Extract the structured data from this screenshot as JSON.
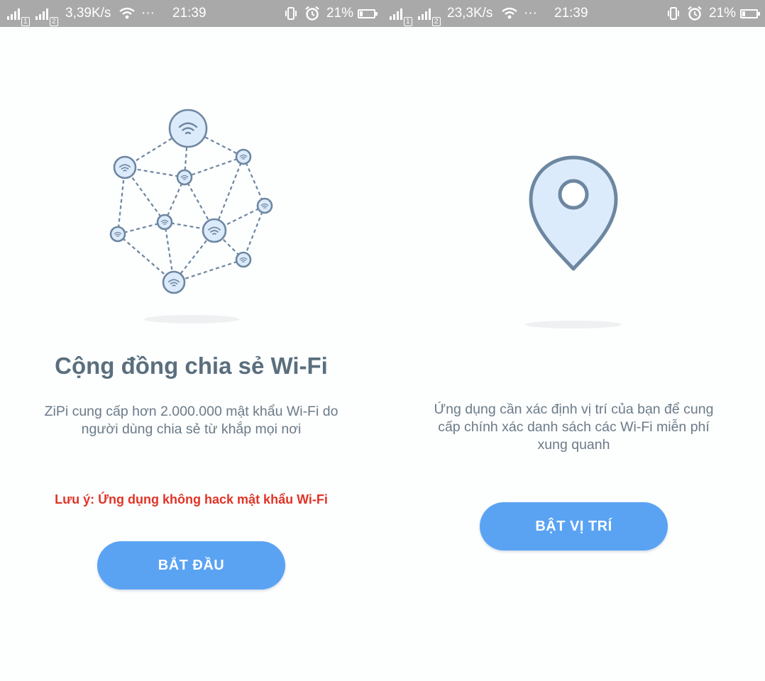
{
  "colors": {
    "status_bar_bg": "#a9a9a9",
    "button_bg": "#5aa3f3",
    "title_text": "#5a6f7e",
    "body_text": "#6b7b88",
    "warning_text": "#e03427",
    "icon_stroke": "#6d87a1",
    "icon_fill": "#dcebfb"
  },
  "left": {
    "status_bar": {
      "network_speed": "3,39K/s",
      "more": "···",
      "time": "21:39",
      "battery": "21%"
    },
    "illustration": "wifi-network-icon",
    "title": "Cộng đồng chia sẻ Wi-Fi",
    "description_line1": "ZiPi cung cấp hơn 2.000.000 mật khẩu Wi-Fi do",
    "description_line2": "người dùng chia sẻ từ khắp mọi nơi",
    "note": "Lưu ý: Ứng dụng không hack mật khẩu Wi-Fi",
    "button_label": "BẮT ĐẦU"
  },
  "right": {
    "status_bar": {
      "network_speed": "23,3K/s",
      "more": "···",
      "time": "21:39",
      "battery": "21%"
    },
    "illustration": "location-pin-icon",
    "description_line1": "Ứng dụng cần xác định vị trí của bạn để cung",
    "description_line2": "cấp chính xác danh sách các Wi-Fi miễn phí",
    "description_line3": "xung quanh",
    "button_label": "BẬT VỊ TRÍ"
  }
}
